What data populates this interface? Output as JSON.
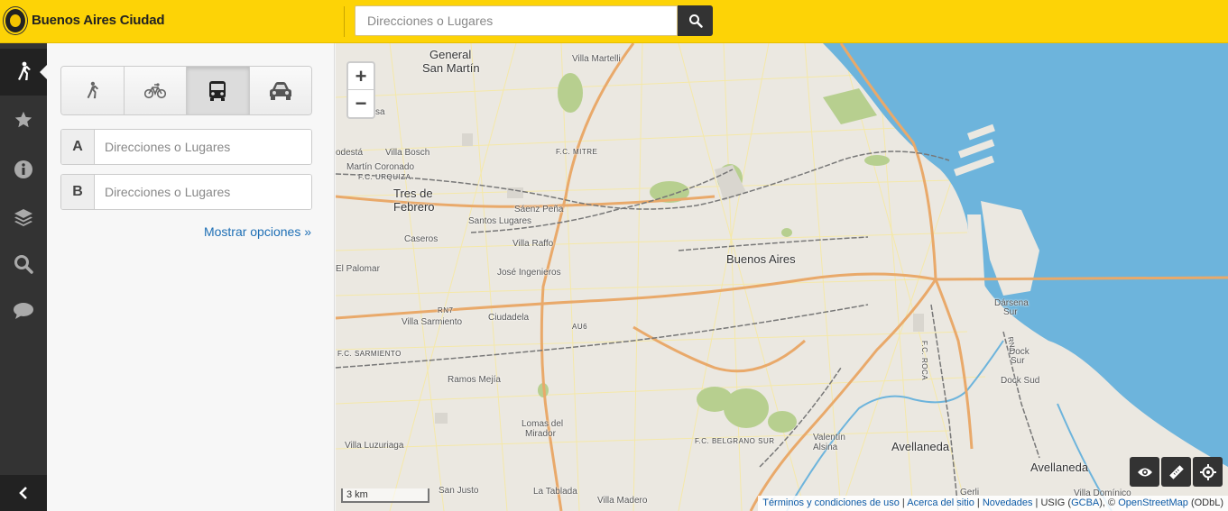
{
  "header": {
    "brand": "Buenos Aires Ciudad",
    "search_placeholder": "Direcciones o Lugares"
  },
  "sidebar_nav": {
    "items": [
      {
        "icon": "walk-icon",
        "active": true
      },
      {
        "icon": "star-icon"
      },
      {
        "icon": "info-icon"
      },
      {
        "icon": "layers-icon"
      },
      {
        "icon": "search-icon"
      },
      {
        "icon": "comment-icon"
      }
    ],
    "collapse_icon": "chevron-left-icon"
  },
  "panel": {
    "modes": [
      "walk",
      "bike",
      "bus",
      "car"
    ],
    "active_mode": "bus",
    "origin_label": "A",
    "destination_label": "B",
    "origin_placeholder": "Direcciones o Lugares",
    "destination_placeholder": "Direcciones o Lugares",
    "more_options": "Mostrar opciones »"
  },
  "map": {
    "zoom_in": "+",
    "zoom_out": "−",
    "scale": "3 km",
    "labels": {
      "l1": "General",
      "l2": "San Martín",
      "l3": "Villa Martelli",
      "l4": "Hermosa",
      "l5": "odestá",
      "l6": "Villa Bosch",
      "l7": "Martín Coronado",
      "l8": "F.C. URQUIZA",
      "l9": "Tres de",
      "l10": "Febrero",
      "l11": "F.C. MITRE",
      "l12": "Sáenz Peña",
      "l13": "Santos Lugares",
      "l14": "Caseros",
      "l15": "Villa Raffo",
      "l16": "El Palomar",
      "l17": "José Ingenieros",
      "l18": "Buenos Aires",
      "l19": "RN7",
      "l20": "Villa Sarmiento",
      "l21": "Ciudadela",
      "l22": "AU6",
      "l23": "F.C. SARMIENTO",
      "l24": "Ramos Mejía",
      "l25": "Lomas del",
      "l26": "Mirador",
      "l27": "Villa Luzuriaga",
      "l28": "F.C. BELGRANO SUR",
      "l29": "San Justo",
      "l30": "La Tablada",
      "l31": "Villa Madero",
      "l32": "Valentín",
      "l33": "Alsina",
      "l34": "Avellaneda",
      "l35": "Gerli",
      "l36": "Avellaneda",
      "l37": "Villa Domínico",
      "l38": "Dock Sud",
      "l39": "Dock",
      "l40": "Sur",
      "l41": "Dársena",
      "l42": "Sur",
      "l43": "F.C. ROCA",
      "l44": "RN1"
    },
    "attribution": {
      "terms": "Términos y condiciones de uso",
      "about": "Acerca del sitio",
      "news": "Novedades",
      "usig": "USIG (",
      "gcba": "GCBA",
      "osm_prefix": "), ©",
      "osm": "OpenStreetMap",
      "odbl": "(ODbL)",
      "sep": "|"
    },
    "colors": {
      "water": "#6db4dc",
      "road_major": "#e9a96a",
      "road_minor": "#f6e8a3",
      "park": "#b7cf8f",
      "land": "#ebe8e1"
    }
  }
}
